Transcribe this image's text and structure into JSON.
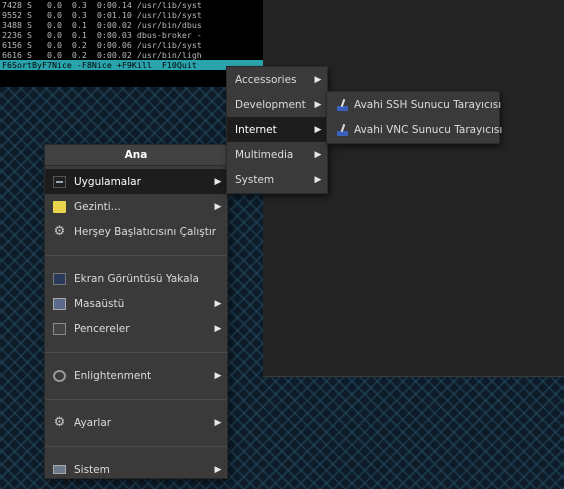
{
  "terminal": {
    "lines": [
      "7428 S   0.0  0.3  0:00.14 /usr/lib/syst",
      "9552 S   0.0  0.3  0:01.10 /usr/lib/syst",
      "3488 S   0.0  0.1  0:00.02 /usr/bin/dbus",
      "2236 S   0.0  0.1  0:00.03 dbus-broker -",
      "6156 S   0.0  0.2  0:00.06 /usr/lib/syst",
      "6616 S   0.0  0.2  0:00.02 /usr/bin/ligh"
    ],
    "fkeys": "F6SortByF7Nice -F8Nice +F9Kill  F10Quit"
  },
  "main_menu": {
    "title": "Ana",
    "items": [
      {
        "label": "Uygulamalar",
        "icon": "applications-icon"
      },
      {
        "label": "Gezinti...",
        "icon": "folder-icon"
      },
      {
        "label": "Herşey Başlatıcısını Çalıştır",
        "icon": "gear-icon"
      },
      {
        "label": "Ekran Görüntüsü Yakala",
        "icon": "screenshot-icon"
      },
      {
        "label": "Masaüstü",
        "icon": "desktop-icon"
      },
      {
        "label": "Pencereler",
        "icon": "windows-icon"
      },
      {
        "label": "Enlightenment",
        "icon": "enlightenment-icon"
      },
      {
        "label": "Ayarlar",
        "icon": "settings-gear-icon"
      },
      {
        "label": "Sistem",
        "icon": "system-icon"
      }
    ]
  },
  "apps_menu": {
    "items": [
      {
        "label": "Accessories"
      },
      {
        "label": "Development"
      },
      {
        "label": "Internet"
      },
      {
        "label": "Multimedia"
      },
      {
        "label": "System"
      }
    ]
  },
  "internet_menu": {
    "items": [
      {
        "label": "Avahi SSH Sunucu Tarayıcısı",
        "icon": "avahi-icon"
      },
      {
        "label": "Avahi VNC Sunucu Tarayıcısı",
        "icon": "avahi-icon"
      }
    ]
  },
  "submenu_arrow": "▶"
}
